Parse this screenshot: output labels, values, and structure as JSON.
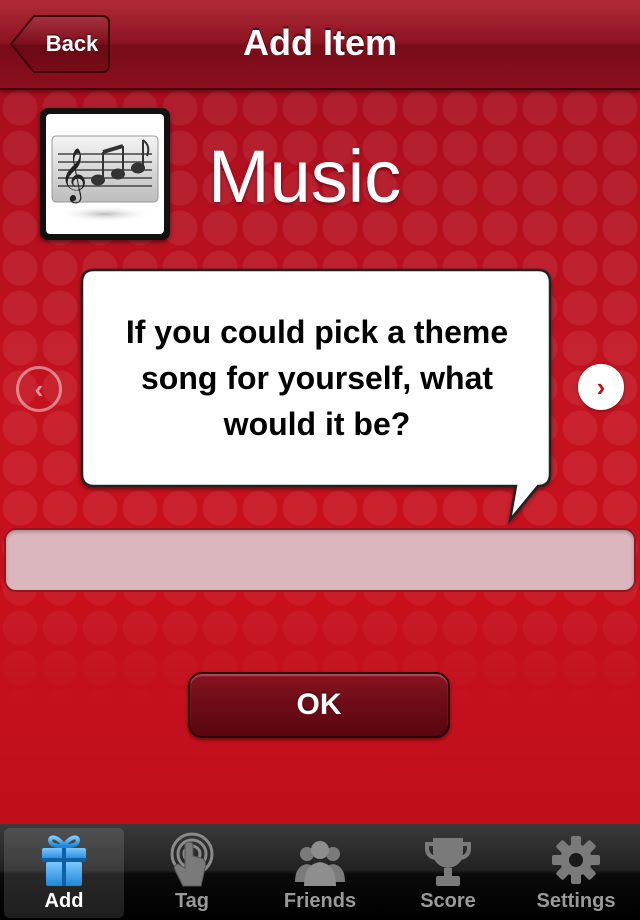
{
  "nav": {
    "back_label": "Back",
    "title": "Add Item"
  },
  "category": {
    "icon": "music-notes-icon",
    "title": "Music"
  },
  "question": {
    "text": "If you could pick a theme song for yourself, what would it be?"
  },
  "answer": {
    "value": "",
    "placeholder": ""
  },
  "ok_label": "OK",
  "arrows": {
    "prev_icon": "chevron-left-icon",
    "next_icon": "chevron-right-icon"
  },
  "tabs": [
    {
      "label": "Add",
      "icon": "gift-icon",
      "active": true
    },
    {
      "label": "Tag",
      "icon": "fingerprint-icon",
      "active": false
    },
    {
      "label": "Friends",
      "icon": "people-icon",
      "active": false
    },
    {
      "label": "Score",
      "icon": "trophy-icon",
      "active": false
    },
    {
      "label": "Settings",
      "icon": "gear-icon",
      "active": false
    }
  ],
  "colors": {
    "background_red": "#c3121f",
    "nav_red": "#8d1422",
    "button_dark_red": "#6e0c17",
    "answer_field": "#dbb7bd",
    "tab_active_blue": "#3aa3e8"
  }
}
